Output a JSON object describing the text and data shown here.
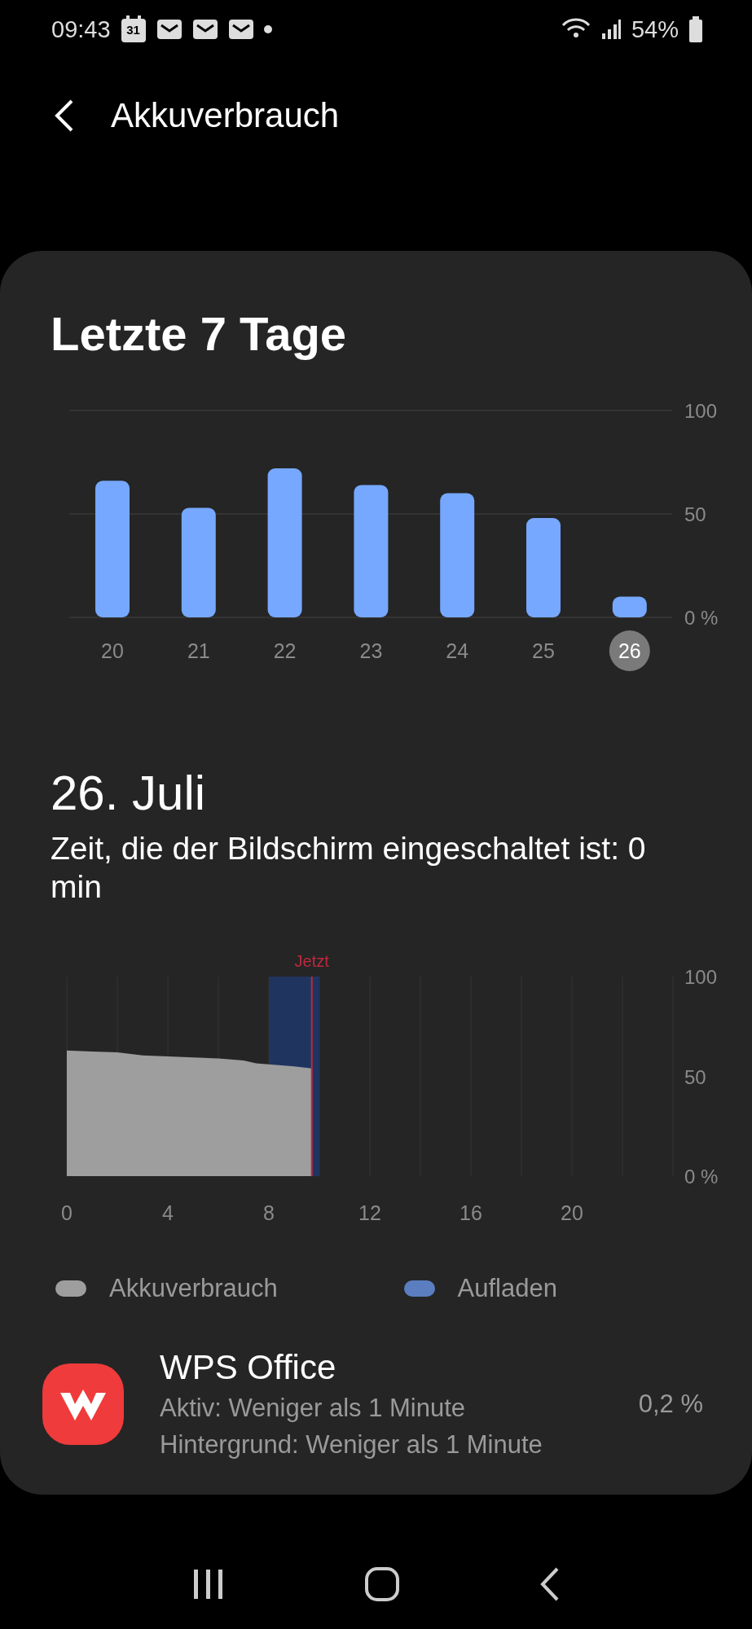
{
  "status_bar": {
    "time": "09:43",
    "calendar_day": "31",
    "battery": "54%"
  },
  "header": {
    "title": "Akkuverbrauch"
  },
  "weekly": {
    "title": "Letzte 7 Tage",
    "chart_data": {
      "type": "bar",
      "categories": [
        "20",
        "21",
        "22",
        "23",
        "24",
        "25",
        "26"
      ],
      "series": [
        {
          "color": "#76a8ff",
          "values": [
            66,
            53,
            72,
            64,
            60,
            48,
            10
          ]
        }
      ],
      "ylim": [
        0,
        100
      ],
      "grid": true,
      "yticks": [
        {
          "value": 0,
          "label": "0 %"
        },
        {
          "value": 50,
          "label": "50"
        },
        {
          "value": 100,
          "label": "100"
        }
      ]
    },
    "category_selected": [
      false,
      false,
      false,
      false,
      false,
      false,
      true
    ]
  },
  "day": {
    "title": "26. Juli",
    "screen_time": "Zeit, die der Bildschirm eingeschaltet ist: 0 min",
    "chart_data": {
      "type": "area",
      "x": [
        0,
        1,
        2,
        3,
        4,
        5,
        6,
        7,
        7.5,
        8,
        9,
        9.7
      ],
      "series": [
        {
          "name": "Akkuverbrauch",
          "color": "#9e9e9e",
          "values": [
            63,
            62.5,
            62,
            60.5,
            60,
            59.5,
            59,
            58,
            56.5,
            56,
            55,
            54
          ]
        }
      ],
      "xlim": [
        0,
        24
      ],
      "ylim": [
        0,
        100
      ],
      "xticks": [
        0,
        4,
        8,
        12,
        16,
        20
      ],
      "grid": true,
      "yticks": [
        {
          "value": 0,
          "label": "0 %"
        },
        {
          "value": 50,
          "label": "50"
        },
        {
          "value": 100,
          "label": "100"
        }
      ],
      "bands": [
        {
          "axis": "x",
          "from": 8,
          "to": 10,
          "label": "Aufladen",
          "color": "#1f3560"
        }
      ],
      "ref_lines": [
        {
          "axis": "x",
          "value": 9.7,
          "label": "Jetzt",
          "color": "#c0283c"
        }
      ]
    }
  },
  "apps": [
    {
      "name": "WPS Office",
      "active": "Aktiv: Weniger als 1 Minute",
      "background": "Hintergrund: Weniger als 1 Minute",
      "share": "0,2 %"
    }
  ]
}
